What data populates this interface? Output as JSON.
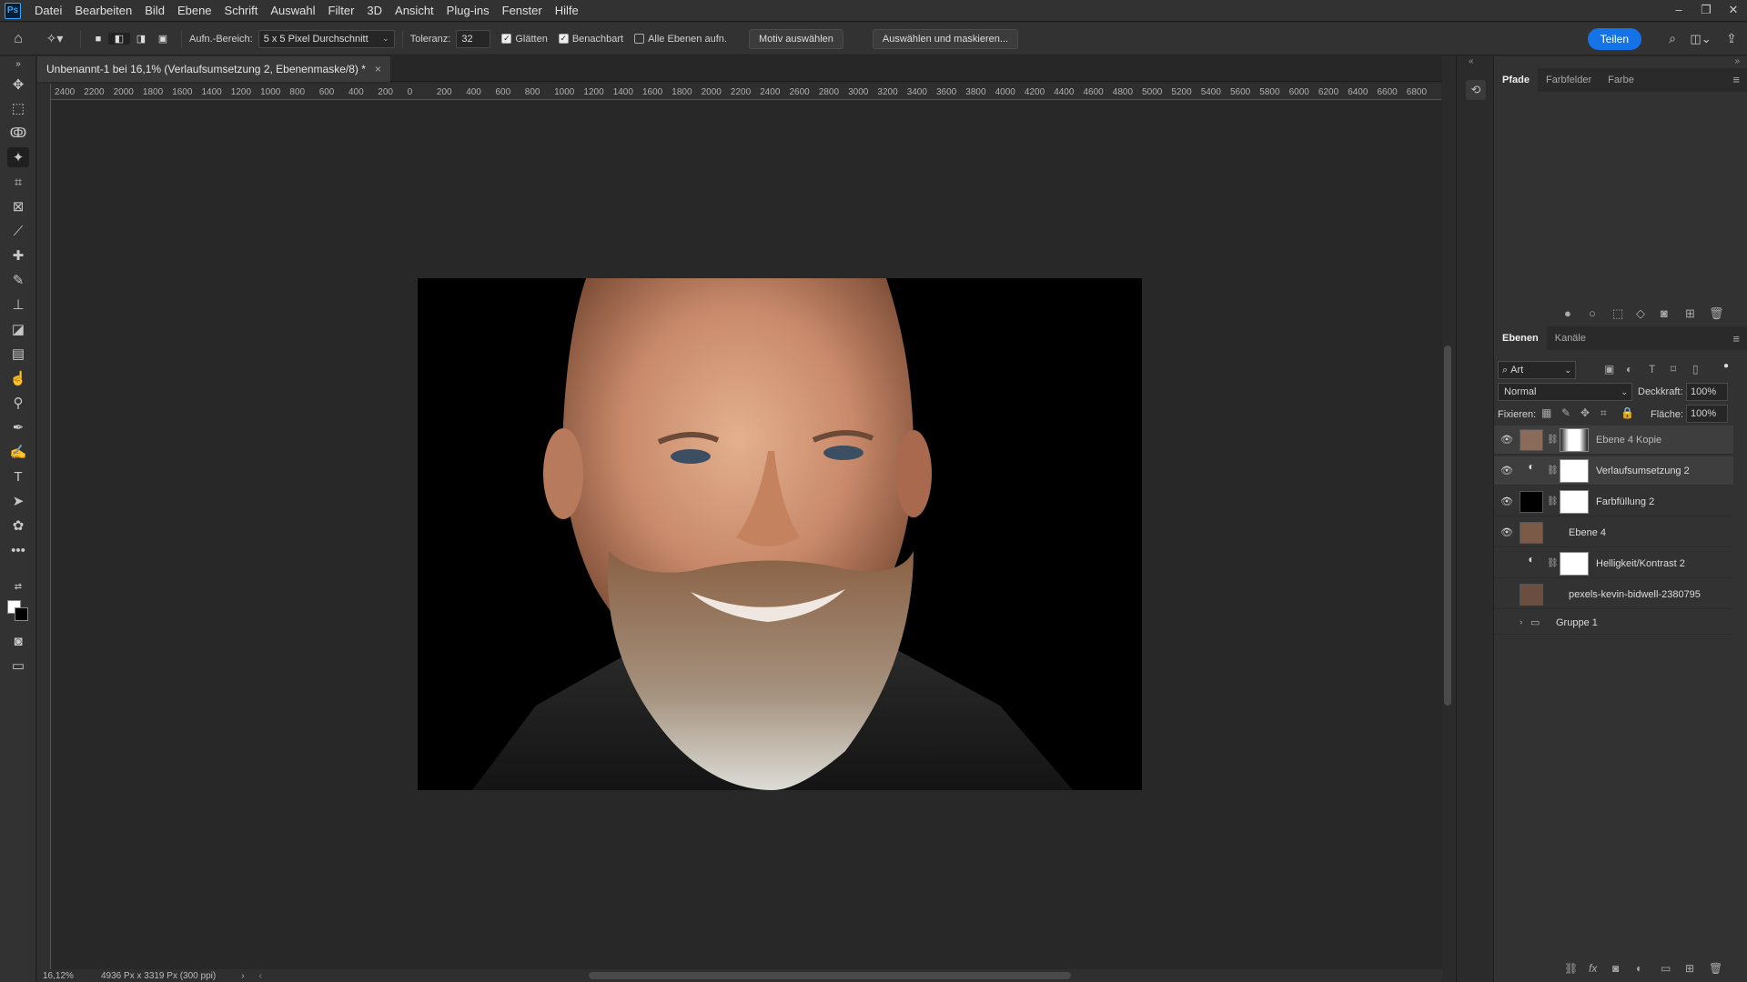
{
  "menubar": {
    "logo": "Ps",
    "items": [
      "Datei",
      "Bearbeiten",
      "Bild",
      "Ebene",
      "Schrift",
      "Auswahl",
      "Filter",
      "3D",
      "Ansicht",
      "Plug-ins",
      "Fenster",
      "Hilfe"
    ],
    "window_controls": [
      "–",
      "❐",
      "✕"
    ]
  },
  "options": {
    "sample_label": "Aufn.-Bereich:",
    "sample_value": "5 x 5 Pixel Durchschnitt",
    "tolerance_label": "Toleranz:",
    "tolerance_value": "32",
    "antialias_label": "Glätten",
    "contiguous_label": "Benachbart",
    "all_layers_label": "Alle Ebenen aufn.",
    "select_subject_label": "Motiv auswählen",
    "select_mask_label": "Auswählen und maskieren...",
    "share_label": "Teilen"
  },
  "document": {
    "tab_title": "Unbenannt-1 bei 16,1% (Verlaufsumsetzung 2, Ebenenmaske/8) *",
    "close": "×",
    "ruler_ticks": [
      "2400",
      "2200",
      "2000",
      "1800",
      "1600",
      "1400",
      "1200",
      "1000",
      "800",
      "600",
      "400",
      "200",
      "0",
      "200",
      "400",
      "600",
      "800",
      "1000",
      "1200",
      "1400",
      "1600",
      "1800",
      "2000",
      "2200",
      "2400",
      "2600",
      "2800",
      "3000",
      "3200",
      "3400",
      "3600",
      "3800",
      "4000",
      "4200",
      "4400",
      "4600",
      "4800",
      "5000",
      "5200",
      "5400",
      "5600",
      "5800",
      "6000",
      "6200",
      "6400",
      "6600",
      "6800"
    ]
  },
  "status": {
    "zoom": "16,12%",
    "doc_info": "4936 Px x 3319 Px (300 ppi)"
  },
  "top_panel": {
    "tabs": [
      "Pfade",
      "Farbfelder",
      "Farbe"
    ],
    "active": "Pfade"
  },
  "layers_panel": {
    "tabs": [
      "Ebenen",
      "Kanäle"
    ],
    "filter_label": "Art",
    "blend_mode": "Normal",
    "opacity_label": "Deckkraft:",
    "opacity_value": "100%",
    "lock_label": "Fixieren:",
    "fill_label": "Fläche:",
    "fill_value": "100%",
    "layers": [
      {
        "name": "Verlaufsumsetzung 2",
        "overlay_name": "Ebene 4 Kopie",
        "visible": true,
        "selected": true
      },
      {
        "name": "Verlaufsumsetzung 2",
        "visible": true,
        "selected": true
      },
      {
        "name": "Farbfüllung 2",
        "visible": true,
        "selected": false
      },
      {
        "name": "Ebene 4",
        "visible": true,
        "selected": false
      },
      {
        "name": "Helligkeit/Kontrast 2",
        "visible": false,
        "selected": false
      },
      {
        "name": "pexels-kevin-bidwell-2380795",
        "visible": false,
        "selected": false
      },
      {
        "name": "Gruppe 1",
        "visible": false,
        "selected": false
      }
    ]
  },
  "colors": {
    "accent": "#1473e6",
    "panel": "#323232",
    "canvas": "#282828"
  }
}
